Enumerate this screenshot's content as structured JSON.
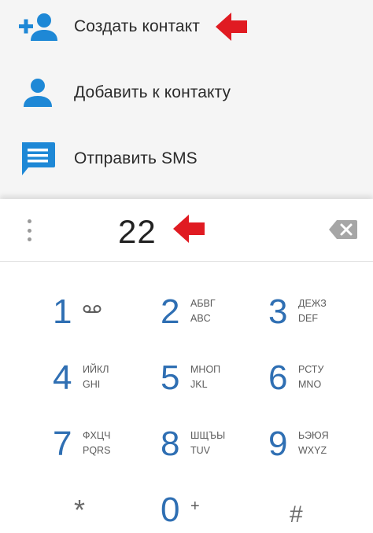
{
  "actions": {
    "create_contact": "Создать контакт",
    "add_to_contact": "Добавить к контакту",
    "send_sms": "Отправить SMS"
  },
  "dialer": {
    "entered_digits": "22"
  },
  "keys": [
    {
      "num": "1",
      "top": "",
      "bottom": "",
      "voicemail": true
    },
    {
      "num": "2",
      "top": "АБВГ",
      "bottom": "ABC"
    },
    {
      "num": "3",
      "top": "ДЕЖЗ",
      "bottom": "DEF"
    },
    {
      "num": "4",
      "top": "ИЙКЛ",
      "bottom": "GHI"
    },
    {
      "num": "5",
      "top": "МНОП",
      "bottom": "JKL"
    },
    {
      "num": "6",
      "top": "РСТУ",
      "bottom": "MNO"
    },
    {
      "num": "7",
      "top": "ФХЦЧ",
      "bottom": "PQRS"
    },
    {
      "num": "8",
      "top": "ШЩЪЫ",
      "bottom": "TUV"
    },
    {
      "num": "9",
      "top": "ЬЭЮЯ",
      "bottom": "WXYZ"
    },
    {
      "num": "*",
      "top": "",
      "bottom": ""
    },
    {
      "num": "0",
      "top": "+",
      "bottom": ""
    },
    {
      "num": "#",
      "top": "",
      "bottom": ""
    }
  ],
  "colors": {
    "accent_blue": "#1e88d6",
    "digit_blue": "#2f6fb3",
    "annotation_red": "#e01b22"
  },
  "icons": {
    "create_contact": "person-add-icon",
    "add_to_contact": "person-icon",
    "send_sms": "message-icon",
    "backspace": "backspace-icon",
    "menu": "overflow-menu-icon",
    "voicemail": "voicemail-icon"
  }
}
